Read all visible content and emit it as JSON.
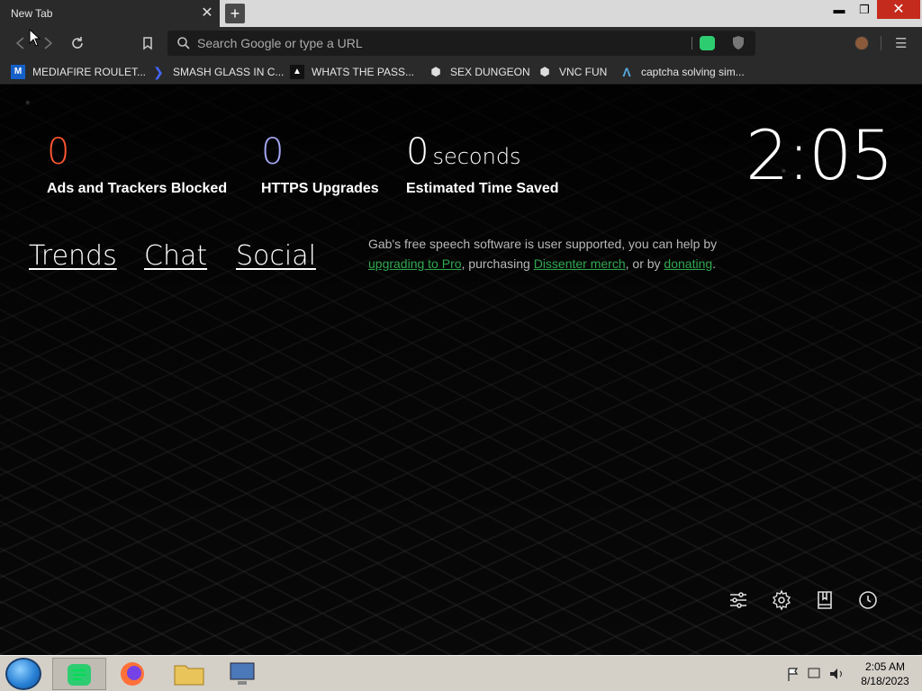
{
  "browser": {
    "tab_title": "New Tab",
    "tab_close": "✕",
    "new_tab": "+",
    "window_min": "▬",
    "window_max": "❐",
    "window_close": "✕",
    "omnibox_placeholder": "Search Google or type a URL"
  },
  "bookmarks": [
    {
      "label": "MEDIAFIRE ROULET...",
      "icon": "mediafire-icon"
    },
    {
      "label": "SMASH GLASS IN C...",
      "icon": "chevron-bracket-icon"
    },
    {
      "label": "WHATS THE PASS...",
      "icon": "ghost-icon"
    },
    {
      "label": "SEX DUNGEON",
      "icon": "cube-icon"
    },
    {
      "label": "VNC FUN",
      "icon": "cube-icon"
    },
    {
      "label": "captcha solving sim...",
      "icon": "aurora-icon"
    }
  ],
  "stats": {
    "ads_count": "0",
    "ads_label": "Ads and Trackers Blocked",
    "https_count": "0",
    "https_label": "HTTPS Upgrades",
    "time_count": "0",
    "time_unit": "seconds",
    "time_label": "Estimated Time Saved",
    "colors": {
      "ads": "#ff5533",
      "https": "#a5a7f5",
      "time": "#ffffff"
    }
  },
  "clock": "2:05",
  "nav_links": [
    "Trends",
    "Chat",
    "Social"
  ],
  "promo": {
    "text1": "Gab's free speech software is user supported, you can help by ",
    "link1": "upgrading to Pro",
    "text2": ", purchasing ",
    "link2": "Dissenter merch",
    "text3": ", or by ",
    "link3": "donating",
    "text4": "."
  },
  "taskbar": {
    "time": "2:05 AM",
    "date": "8/18/2023"
  }
}
